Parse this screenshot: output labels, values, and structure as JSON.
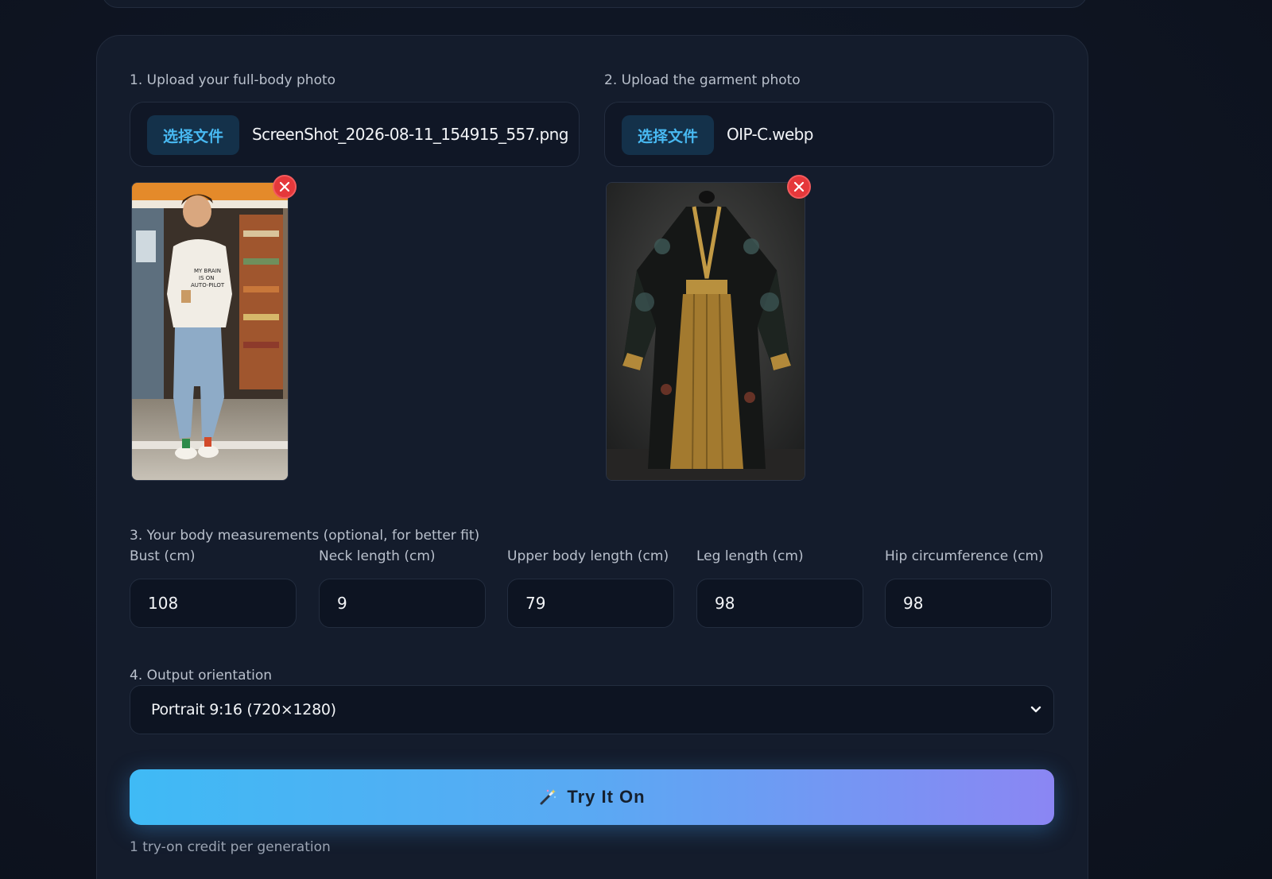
{
  "upload_body": {
    "label": "1. Upload your full-body photo",
    "button_label": "选择文件",
    "file_name": "ScreenShot_2026-08-11_154915_557.png"
  },
  "upload_garment": {
    "label": "2. Upload the garment photo",
    "button_label": "选择文件",
    "file_name": "OIP-C.webp"
  },
  "measurements": {
    "label": "3. Your body measurements (optional, for better fit)",
    "fields": [
      {
        "label": "Bust (cm)",
        "value": "108"
      },
      {
        "label": "Neck length (cm)",
        "value": "9"
      },
      {
        "label": "Upper body length (cm)",
        "value": "79"
      },
      {
        "label": "Leg length (cm)",
        "value": "98"
      },
      {
        "label": "Hip circumference (cm)",
        "value": "98"
      }
    ]
  },
  "orientation": {
    "label": "4. Output orientation",
    "selected": "Portrait 9:16 (720×1280)"
  },
  "submit": {
    "icon": "magic-wand-icon",
    "label": "Try It On",
    "note": "1 try-on credit per generation"
  },
  "colors": {
    "accent_start": "#3fbaf5",
    "accent_end": "#8b86f3",
    "remove": "#e5383b"
  }
}
